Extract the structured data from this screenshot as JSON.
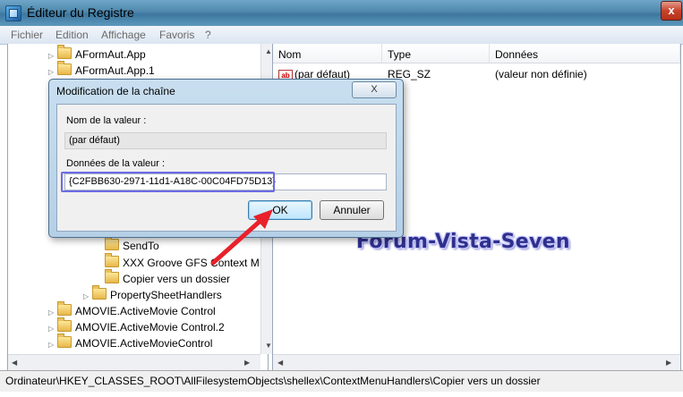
{
  "window": {
    "title": "Éditeur du Registre",
    "close_glyph": "x"
  },
  "menu": [
    "Fichier",
    "Edition",
    "Affichage",
    "Favoris",
    "?"
  ],
  "tree": {
    "items": [
      {
        "label": "AFormAut.App"
      },
      {
        "label": "AFormAut.App.1"
      },
      {
        "label": "SendTo"
      },
      {
        "label": "XXX Groove GFS Context M"
      },
      {
        "label": "Copier vers un dossier"
      },
      {
        "label": "PropertySheetHandlers"
      },
      {
        "label": "AMOVIE.ActiveMovie Control"
      },
      {
        "label": "AMOVIE.ActiveMovie Control.2"
      },
      {
        "label": "AMOVIE.ActiveMovieControl"
      }
    ]
  },
  "list": {
    "columns": [
      "Nom",
      "Type",
      "Données"
    ],
    "rows": [
      {
        "icon": "ab",
        "name": "(par défaut)",
        "type": "REG_SZ",
        "data": "(valeur non définie)"
      }
    ]
  },
  "dialog": {
    "title": "Modification de la chaîne",
    "close_glyph": "X",
    "name_label": "Nom de la valeur :",
    "name_value": "(par défaut)",
    "data_label": "Données de la valeur :",
    "data_value": "{C2FBB630-2971-11d1-A18C-00C04FD75D13}",
    "ok_label": "OK",
    "cancel_label": "Annuler"
  },
  "status": {
    "path": "Ordinateur\\HKEY_CLASSES_ROOT\\AllFilesystemObjects\\shellex\\ContextMenuHandlers\\Copier vers un dossier"
  },
  "watermark": {
    "text": "Forum-Vista-Seven"
  },
  "colors": {
    "annotation_arrow": "#e8212a",
    "highlight_ring": "#6d6ae6",
    "watermark": "#2f2f8c"
  }
}
